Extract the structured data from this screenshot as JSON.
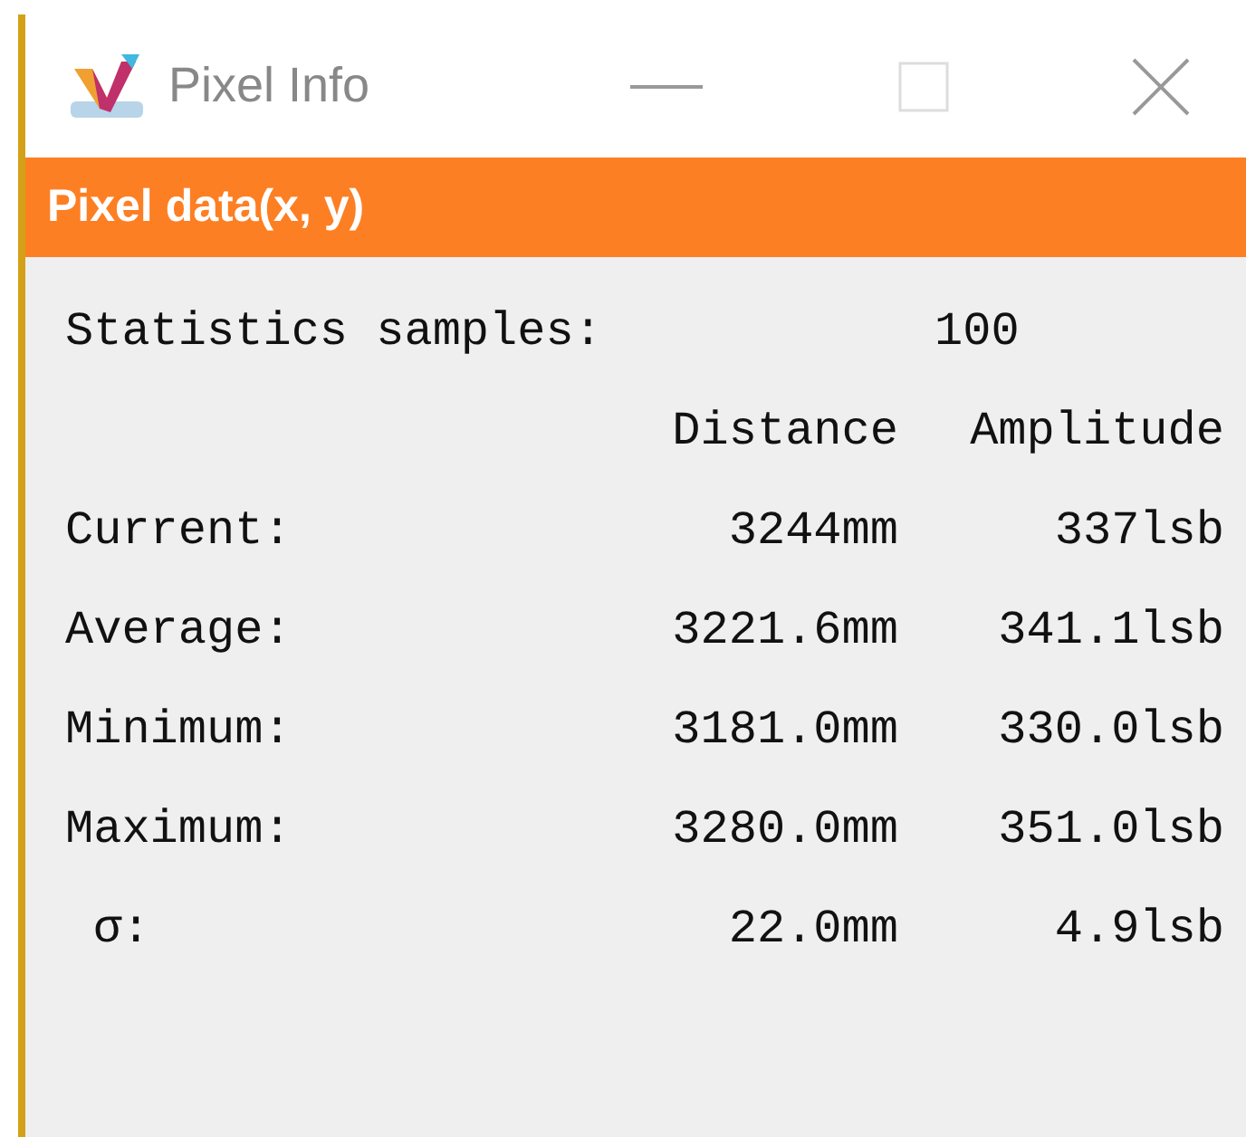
{
  "window": {
    "title": "Pixel Info"
  },
  "header": "Pixel data(x, y)",
  "samples": {
    "label": "Statistics samples:",
    "value": "100"
  },
  "columns": [
    "Distance",
    "Amplitude"
  ],
  "rows": [
    {
      "label": "Current:",
      "distance": "3244mm",
      "amplitude": "337lsb"
    },
    {
      "label": "Average:",
      "distance": "3221.6mm",
      "amplitude": "341.1lsb"
    },
    {
      "label": "Minimum:",
      "distance": "3181.0mm",
      "amplitude": "330.0lsb"
    },
    {
      "label": "Maximum:",
      "distance": "3280.0mm",
      "amplitude": "351.0lsb"
    },
    {
      "label": " σ:",
      "distance": "22.0mm",
      "amplitude": "4.9lsb"
    }
  ]
}
